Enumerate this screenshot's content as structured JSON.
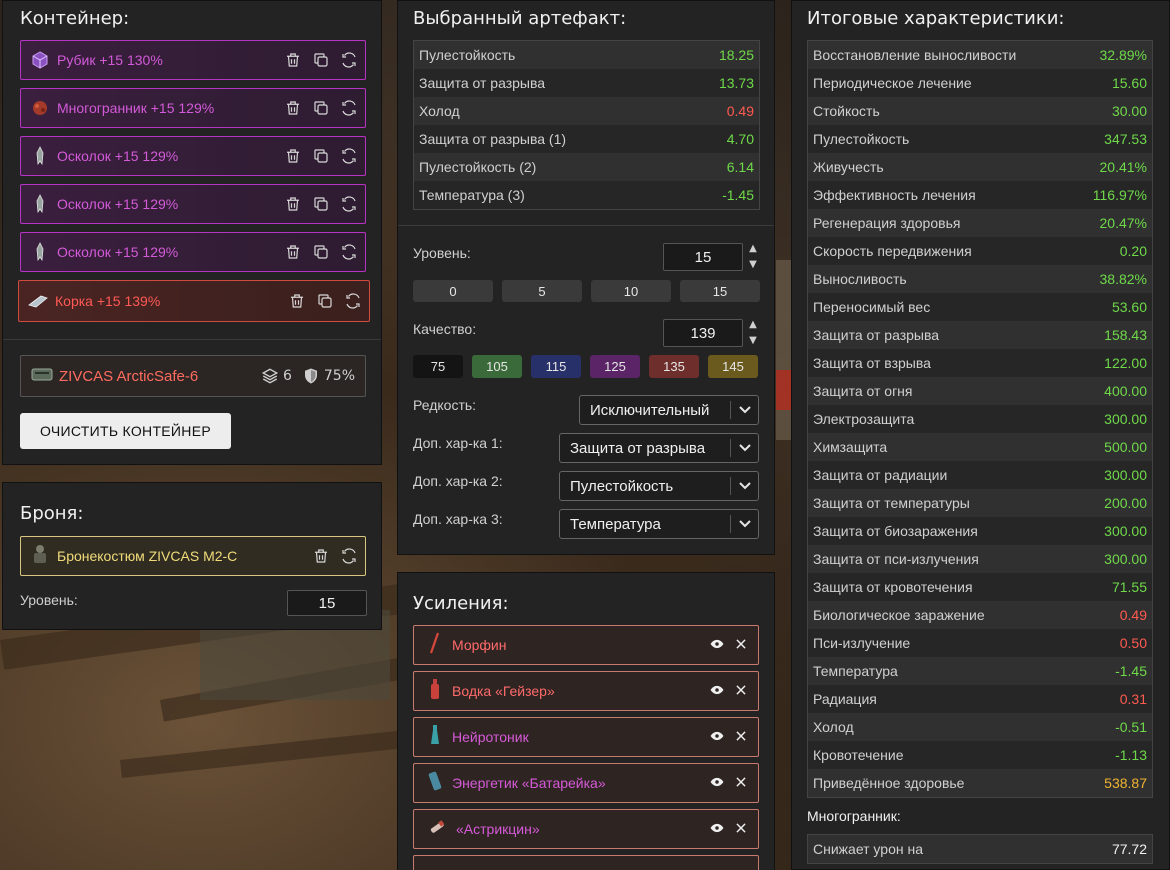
{
  "container": {
    "title": "Контейнер:",
    "artifacts": [
      {
        "name": "Рубик +15 130%",
        "icon": "cube-artifact-icon",
        "style": "purple"
      },
      {
        "name": "Многогранник +15 129%",
        "icon": "polyhedron-artifact-icon",
        "style": "purple"
      },
      {
        "name": "Осколок +15 129%",
        "icon": "shard-artifact-icon",
        "style": "purple"
      },
      {
        "name": "Осколок +15 129%",
        "icon": "shard-artifact-icon",
        "style": "purple"
      },
      {
        "name": "Осколок +15 129%",
        "icon": "shard-artifact-icon",
        "style": "purple"
      },
      {
        "name": "Корка +15 139%",
        "icon": "crust-artifact-icon",
        "style": "red"
      }
    ],
    "case": {
      "name": "ZIVCAS ArcticSafe-6",
      "slots": "6",
      "protection": "75%"
    },
    "clear_button": "ОЧИСТИТЬ КОНТЕЙНЕР"
  },
  "armor": {
    "title": "Броня:",
    "name": "Бронекостюм ZIVCAS M2-C",
    "level_label": "Уровень:",
    "level_value": "15"
  },
  "selected": {
    "title": "Выбранный артефакт:",
    "stats": [
      {
        "label": "Пулестойкость",
        "value": "18.25",
        "tone": "pos"
      },
      {
        "label": "Защита от разрыва",
        "value": "13.73",
        "tone": "pos"
      },
      {
        "label": "Холод",
        "value": "0.49",
        "tone": "neg"
      },
      {
        "label": "Защита от разрыва (1)",
        "value": "4.70",
        "tone": "pos"
      },
      {
        "label": "Пулестойкость (2)",
        "value": "6.14",
        "tone": "pos"
      },
      {
        "label": "Температура (3)",
        "value": "-1.45",
        "tone": "pos"
      }
    ],
    "level_label": "Уровень:",
    "level_value": "15",
    "level_presets": [
      "0",
      "5",
      "10",
      "15"
    ],
    "quality_label": "Качество:",
    "quality_value": "139",
    "quality_presets": [
      {
        "label": "75",
        "color": "#141414"
      },
      {
        "label": "105",
        "color": "#3b6a3a"
      },
      {
        "label": "115",
        "color": "#28306a"
      },
      {
        "label": "125",
        "color": "#5a2466"
      },
      {
        "label": "135",
        "color": "#6e2e2c"
      },
      {
        "label": "145",
        "color": "#6a5a1e"
      }
    ],
    "rarity_label": "Редкость:",
    "rarity_value": "Исключительный",
    "extra1_label": "Доп. хар-ка 1:",
    "extra1_value": "Защита от разрыва",
    "extra2_label": "Доп. хар-ка 2:",
    "extra2_value": "Пулестойкость",
    "extra3_label": "Доп. хар-ка 3:",
    "extra3_value": "Температура"
  },
  "boosts": {
    "title": "Усиления:",
    "items": [
      {
        "name": "Морфин",
        "icon": "syringe-icon",
        "color": "#ff6b6b"
      },
      {
        "name": "Водка «Гейзер»",
        "icon": "bottle-icon",
        "color": "#ff6b6b"
      },
      {
        "name": "Нейротоник",
        "icon": "vial-icon",
        "color": "#d65ad8"
      },
      {
        "name": "Энергетик «Батарейка»",
        "icon": "energy-can-icon",
        "color": "#d65ad8"
      },
      {
        "name": "«Астрикцин»",
        "icon": "injector-icon",
        "color": "#d65ad8"
      }
    ]
  },
  "totals": {
    "title": "Итоговые характеристики:",
    "stats": [
      {
        "label": "Восстановление выносливости",
        "value": "32.89%",
        "tone": "pos"
      },
      {
        "label": "Периодическое лечение",
        "value": "15.60",
        "tone": "pos"
      },
      {
        "label": "Стойкость",
        "value": "30.00",
        "tone": "pos"
      },
      {
        "label": "Пулестойкость",
        "value": "347.53",
        "tone": "pos"
      },
      {
        "label": "Живучесть",
        "value": "20.41%",
        "tone": "pos"
      },
      {
        "label": "Эффективность лечения",
        "value": "116.97%",
        "tone": "pos"
      },
      {
        "label": "Регенерация здоровья",
        "value": "20.47%",
        "tone": "pos"
      },
      {
        "label": "Скорость передвижения",
        "value": "0.20",
        "tone": "pos"
      },
      {
        "label": "Выносливость",
        "value": "38.82%",
        "tone": "pos"
      },
      {
        "label": "Переносимый вес",
        "value": "53.60",
        "tone": "pos"
      },
      {
        "label": "Защита от разрыва",
        "value": "158.43",
        "tone": "pos"
      },
      {
        "label": "Защита от взрыва",
        "value": "122.00",
        "tone": "pos"
      },
      {
        "label": "Защита от огня",
        "value": "400.00",
        "tone": "pos"
      },
      {
        "label": "Электрозащита",
        "value": "300.00",
        "tone": "pos"
      },
      {
        "label": "Химзащита",
        "value": "500.00",
        "tone": "pos"
      },
      {
        "label": "Защита от радиации",
        "value": "300.00",
        "tone": "pos"
      },
      {
        "label": "Защита от температуры",
        "value": "200.00",
        "tone": "pos"
      },
      {
        "label": "Защита от биозаражения",
        "value": "300.00",
        "tone": "pos"
      },
      {
        "label": "Защита от пси-излучения",
        "value": "300.00",
        "tone": "pos"
      },
      {
        "label": "Защита от кровотечения",
        "value": "71.55",
        "tone": "pos"
      },
      {
        "label": "Биологическое заражение",
        "value": "0.49",
        "tone": "neg"
      },
      {
        "label": "Пси-излучение",
        "value": "0.50",
        "tone": "neg"
      },
      {
        "label": "Температура",
        "value": "-1.45",
        "tone": "pos"
      },
      {
        "label": "Радиация",
        "value": "0.31",
        "tone": "neg"
      },
      {
        "label": "Холод",
        "value": "-0.51",
        "tone": "pos"
      },
      {
        "label": "Кровотечение",
        "value": "-1.13",
        "tone": "pos"
      },
      {
        "label": "Приведённое здоровье",
        "value": "538.87",
        "tone": "gold"
      }
    ],
    "multi_title": "Многогранник:",
    "multi_stats": [
      {
        "label": "Снижает урон на",
        "value": "77.72",
        "tone": "white"
      }
    ]
  }
}
